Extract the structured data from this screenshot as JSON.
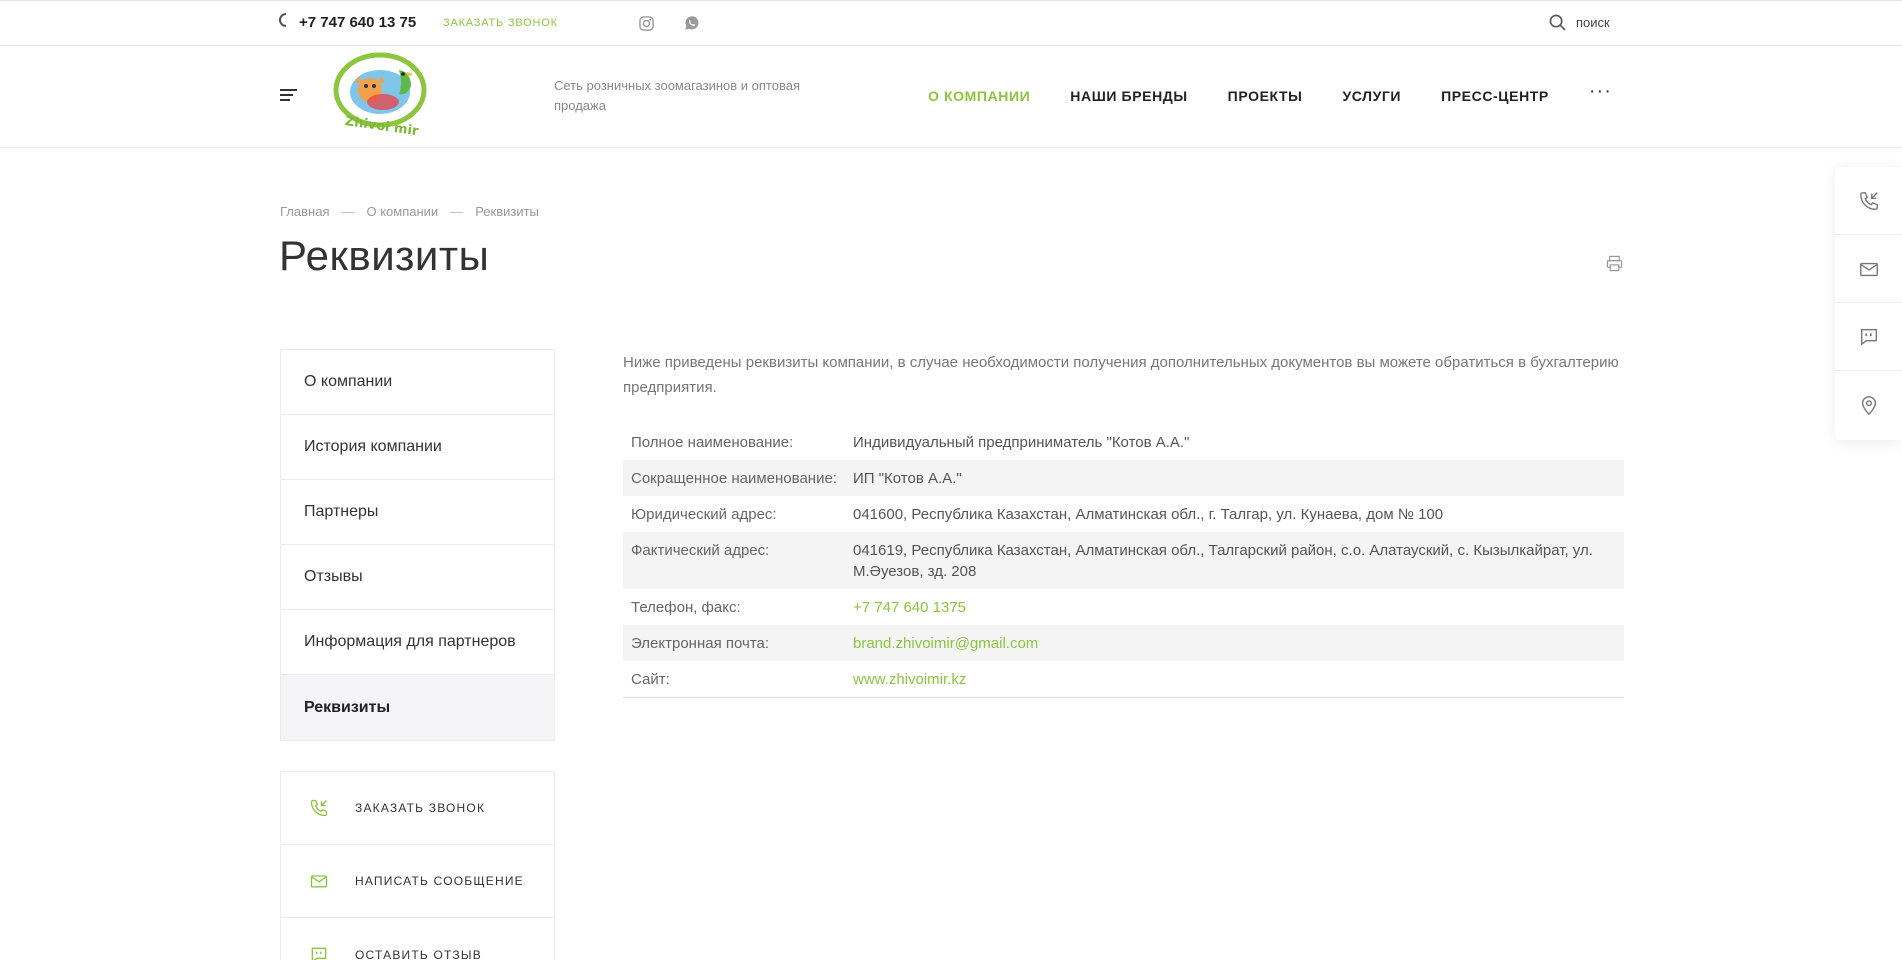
{
  "topbar": {
    "phone": "+7 747 640 13 75",
    "callback": "ЗАКАЗАТЬ ЗВОНОК",
    "search_label": "поиск"
  },
  "header": {
    "logo_text": "Zhivoi mir",
    "tagline": "Сеть розничных зоомагазинов и оптовая продажа",
    "nav": [
      {
        "label": "О КОМПАНИИ",
        "active": true
      },
      {
        "label": "НАШИ БРЕНДЫ",
        "active": false
      },
      {
        "label": "ПРОЕКТЫ",
        "active": false
      },
      {
        "label": "УСЛУГИ",
        "active": false
      },
      {
        "label": "ПРЕСС-ЦЕНТР",
        "active": false
      }
    ],
    "more": "···"
  },
  "breadcrumb": {
    "items": [
      "Главная",
      "О компании",
      "Реквизиты"
    ],
    "separator": "—"
  },
  "page": {
    "title": "Реквизиты",
    "intro": "Ниже приведены реквизиты компании, в случае необходимости получения дополнительных документов вы можете обратиться в бухгалтерию предприятия."
  },
  "left_menu": {
    "items": [
      {
        "label": "О компании",
        "active": false
      },
      {
        "label": "История компании",
        "active": false
      },
      {
        "label": "Партнеры",
        "active": false
      },
      {
        "label": "Отзывы",
        "active": false
      },
      {
        "label": "Информация для партнеров",
        "active": false
      },
      {
        "label": "Реквизиты",
        "active": true
      }
    ]
  },
  "left_actions": {
    "items": [
      {
        "label": "ЗАКАЗАТЬ ЗВОНОК",
        "icon": "phone-callback-icon"
      },
      {
        "label": "НАПИСАТЬ СООБЩЕНИЕ",
        "icon": "envelope-icon"
      },
      {
        "label": "ОСТАВИТЬ ОТЗЫВ",
        "icon": "review-chat-icon"
      }
    ]
  },
  "requisites": {
    "rows": [
      {
        "label": "Полное наименование:",
        "value": "Индивидуальный предприниматель \"Котов А.А.\"",
        "link": false
      },
      {
        "label": "Сокращенное наименование:",
        "value": "ИП \"Котов А.А.\"",
        "link": false
      },
      {
        "label": "Юридический адрес:",
        "value": "041600, Республика Казахстан, Алматинская обл., г. Талгар, ул. Кунаева, дом № 100",
        "link": false
      },
      {
        "label": "Фактический адрес:",
        "value": "041619, Республика Казахстан, Алматинская обл., Талгарский район, с.о. Алатауский, с. Кызылкайрат, ул. М.Әуезов, зд. 208",
        "link": false
      },
      {
        "label": "Телефон, факс:",
        "value": "+7 747 640 1375",
        "link": true
      },
      {
        "label": "Электронная почта:",
        "value": "brand.zhivoimir@gmail.com",
        "link": true
      },
      {
        "label": "Сайт:",
        "value": "www.zhivoimir.kz",
        "link": true
      }
    ]
  },
  "side_widget": {
    "icons": [
      "phone-callback-icon",
      "envelope-icon",
      "review-chat-icon",
      "location-pin-icon"
    ]
  },
  "colors": {
    "accent": "#8cc63f",
    "text": "#333333",
    "muted": "#999999",
    "row_alt": "#f4f4f4"
  }
}
